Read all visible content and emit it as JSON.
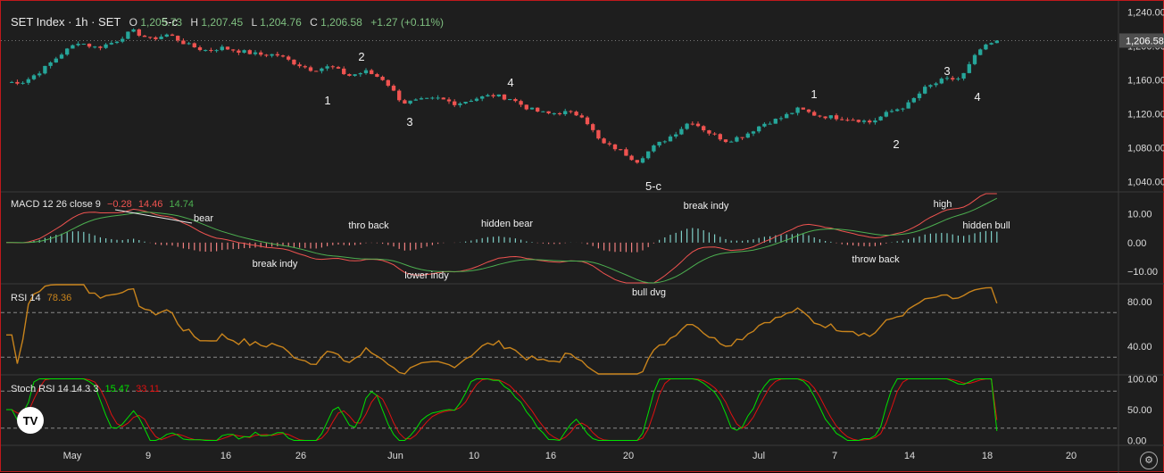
{
  "header": {
    "symbol": "SET Index · 1h · SET",
    "o_label": "O",
    "o_value": "1,205.73",
    "h_label": "H",
    "h_value": "1,207.45",
    "l_label": "L",
    "l_value": "1,204.76",
    "c_label": "C",
    "c_value": "1,206.58",
    "change": "+1.27 (+0.11%)"
  },
  "colors": {
    "up": "#26a69a",
    "down": "#ef5350",
    "macd": "#ef5350",
    "signal": "#4caf50",
    "rsi": "#c9841c",
    "k": "#00e000",
    "d": "#e01010",
    "text": "#dcdcdc",
    "price_tag": "#4e4e4e"
  },
  "panes": {
    "macd": {
      "title": "MACD 12 26 close 9",
      "v1": "−0.28",
      "v2": "14.46",
      "v3": "14.74"
    },
    "rsi": {
      "title": "RSI 14",
      "value": "78.36"
    },
    "stoch": {
      "title": "Stoch RSI 14 14 3 3",
      "k": "15.47",
      "d": "33.11"
    }
  },
  "price_tag": "1,206.58",
  "chart_data": [
    {
      "type": "candlestick",
      "title": "SET Index · 1h · SET",
      "ylim": [
        1030,
        1245
      ],
      "y_ticks": [
        "1,240.00",
        "1,200.00",
        "1,160.00",
        "1,120.00",
        "1,080.00",
        "1,040.00"
      ],
      "x_ticks": [
        "May",
        "9",
        "16",
        "26",
        "Jun",
        "10",
        "16",
        "20",
        "Jul",
        "7",
        "14",
        "18",
        "20"
      ],
      "close_path": [
        {
          "x": "May 1",
          "y": 1157
        },
        {
          "x": "May 3",
          "y": 1158
        },
        {
          "x": "May 6",
          "y": 1172
        },
        {
          "x": "May 7",
          "y": 1190
        },
        {
          "x": "May 8",
          "y": 1205
        },
        {
          "x": "May 9",
          "y": 1198
        },
        {
          "x": "May 10",
          "y": 1205
        },
        {
          "x": "May 13",
          "y": 1218
        },
        {
          "x": "May 14",
          "y": 1208
        },
        {
          "x": "May 15",
          "y": 1214
        },
        {
          "x": "May 16",
          "y": 1202
        },
        {
          "x": "May 17",
          "y": 1195
        },
        {
          "x": "May 20",
          "y": 1198
        },
        {
          "x": "May 22",
          "y": 1194
        },
        {
          "x": "May 23",
          "y": 1190
        },
        {
          "x": "May 24",
          "y": 1190
        },
        {
          "x": "May 27",
          "y": 1180
        },
        {
          "x": "May 28",
          "y": 1172
        },
        {
          "x": "May 29",
          "y": 1176
        },
        {
          "x": "May 30",
          "y": 1165
        },
        {
          "x": "May 31",
          "y": 1170
        },
        {
          "x": "Jun 3",
          "y": 1160
        },
        {
          "x": "Jun 4",
          "y": 1133
        },
        {
          "x": "Jun 5",
          "y": 1136
        },
        {
          "x": "Jun 6",
          "y": 1138
        },
        {
          "x": "Jun 7",
          "y": 1132
        },
        {
          "x": "Jun 10",
          "y": 1138
        },
        {
          "x": "Jun 11",
          "y": 1142
        },
        {
          "x": "Jun 12",
          "y": 1138
        },
        {
          "x": "Jun 13",
          "y": 1126
        },
        {
          "x": "Jun 14",
          "y": 1120
        },
        {
          "x": "Jun 17",
          "y": 1122
        },
        {
          "x": "Jun 18",
          "y": 1118
        },
        {
          "x": "Jun 19",
          "y": 1086
        },
        {
          "x": "Jun 20",
          "y": 1078
        },
        {
          "x": "Jun 21",
          "y": 1064
        },
        {
          "x": "Jun 24",
          "y": 1082
        },
        {
          "x": "Jun 25",
          "y": 1095
        },
        {
          "x": "Jun 26",
          "y": 1112
        },
        {
          "x": "Jun 27",
          "y": 1098
        },
        {
          "x": "Jun 28",
          "y": 1088
        },
        {
          "x": "Jul 1",
          "y": 1095
        },
        {
          "x": "Jul 2",
          "y": 1108
        },
        {
          "x": "Jul 3",
          "y": 1115
        },
        {
          "x": "Jul 4",
          "y": 1126
        },
        {
          "x": "Jul 5",
          "y": 1118
        },
        {
          "x": "Jul 8",
          "y": 1116
        },
        {
          "x": "Jul 9",
          "y": 1114
        },
        {
          "x": "Jul 10",
          "y": 1110
        },
        {
          "x": "Jul 11",
          "y": 1122
        },
        {
          "x": "Jul 12",
          "y": 1130
        },
        {
          "x": "Jul 15",
          "y": 1150
        },
        {
          "x": "Jul 16",
          "y": 1160
        },
        {
          "x": "Jul 17",
          "y": 1162
        },
        {
          "x": "Jul 18",
          "y": 1195
        },
        {
          "x": "Jul 19",
          "y": 1206.58
        }
      ],
      "annotations": [
        "5-c",
        "2",
        "1",
        "3",
        "4",
        "5-c",
        "1",
        "2",
        "3",
        "4"
      ]
    },
    {
      "type": "line",
      "title": "MACD 12 26 close 9",
      "ylim": [
        -14,
        17
      ],
      "y_ticks": [
        "10.00",
        "0.00",
        "−10.00"
      ],
      "annotations": [
        "bear",
        "thro back",
        "hidden bear",
        "break indy",
        "lower indy",
        "bull dvg",
        "break indy",
        "throw back",
        "high",
        "hidden bull"
      ]
    },
    {
      "type": "line",
      "title": "RSI 14",
      "ylim": [
        15,
        95
      ],
      "y_ticks": [
        "80.00",
        "40.00"
      ],
      "levels": [
        70,
        30
      ],
      "last": 78.36
    },
    {
      "type": "line",
      "title": "Stoch RSI 14 14 3 3",
      "ylim": [
        -5,
        105
      ],
      "y_ticks": [
        "100.00",
        "50.00",
        "0.00"
      ],
      "levels": [
        80,
        20
      ],
      "k_last": 15.47,
      "d_last": 33.11
    }
  ]
}
